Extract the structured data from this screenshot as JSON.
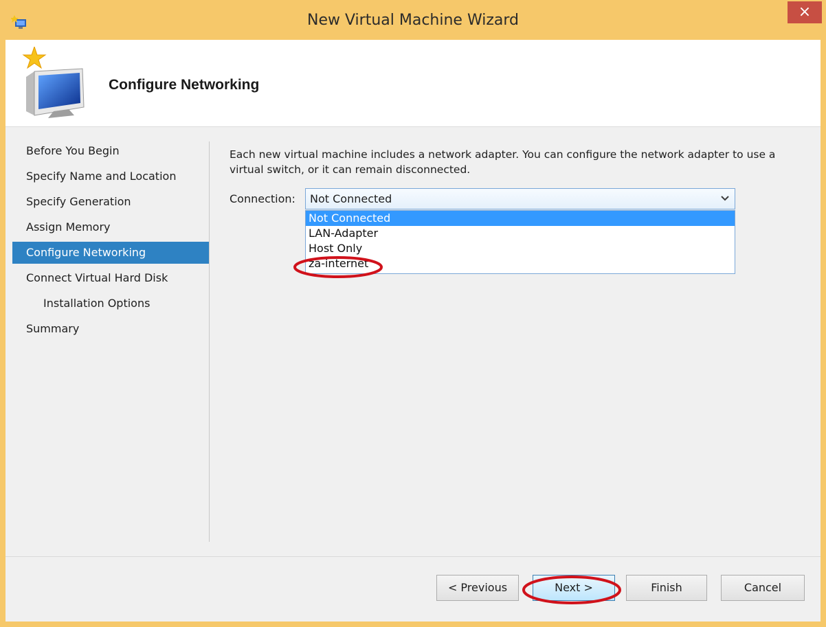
{
  "window": {
    "title": "New Virtual Machine Wizard",
    "close_glyph": "×"
  },
  "header": {
    "title": "Configure Networking",
    "icon": "new-vm-wizard-icon"
  },
  "nav": {
    "items": [
      {
        "label": "Before You Begin",
        "selected": false,
        "indent": false
      },
      {
        "label": "Specify Name and Location",
        "selected": false,
        "indent": false
      },
      {
        "label": "Specify Generation",
        "selected": false,
        "indent": false
      },
      {
        "label": "Assign Memory",
        "selected": false,
        "indent": false
      },
      {
        "label": "Configure Networking",
        "selected": true,
        "indent": false
      },
      {
        "label": "Connect Virtual Hard Disk",
        "selected": false,
        "indent": false
      },
      {
        "label": "Installation Options",
        "selected": false,
        "indent": true
      },
      {
        "label": "Summary",
        "selected": false,
        "indent": false
      }
    ]
  },
  "main": {
    "description": "Each new virtual machine includes a network adapter. You can configure the network adapter to use a virtual switch, or it can remain disconnected.",
    "connection_label": "Connection:",
    "connection_value": "Not Connected",
    "options": [
      {
        "label": "Not Connected",
        "highlighted": true
      },
      {
        "label": "LAN-Adapter",
        "highlighted": false
      },
      {
        "label": "Host Only",
        "highlighted": false
      },
      {
        "label": "za-internet",
        "highlighted": false
      }
    ]
  },
  "footer": {
    "previous_label": "< Previous",
    "next_label": "Next >",
    "finish_label": "Finish",
    "cancel_label": "Cancel"
  },
  "colors": {
    "title_bar": "#f6c86a",
    "close_button": "#c74f43",
    "nav_selected": "#2e82c3",
    "option_selected": "#3399ff",
    "annotation": "#d0121b"
  }
}
